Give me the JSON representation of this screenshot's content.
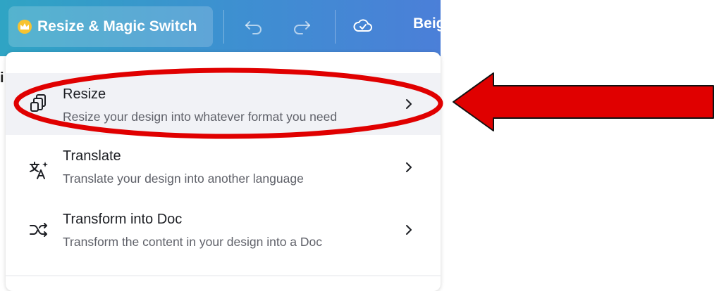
{
  "toolbar": {
    "resize_button_label": "Resize & Magic Switch",
    "project_name": "Beig",
    "icons": [
      "crown-icon",
      "undo-icon",
      "redo-icon",
      "cloud-check-icon"
    ]
  },
  "background": {
    "cropped_text": "i"
  },
  "menu": {
    "items": [
      {
        "title": "Resize",
        "description": "Resize your design into whatever format you need",
        "icon": "resize-icon",
        "highlighted": true
      },
      {
        "title": "Translate",
        "description": "Translate your design into another language",
        "icon": "translate-icon",
        "highlighted": false
      },
      {
        "title": "Transform into Doc",
        "description": "Transform the content in your design into a Doc",
        "icon": "transform-icon",
        "highlighted": false
      }
    ]
  },
  "annotations": {
    "ellipse_color": "#e00000",
    "arrow_color": "#e00000",
    "arrow_outline": "#111111"
  },
  "colors": {
    "toolbar_start": "#2fa4c4",
    "toolbar_end": "#4b7fd8",
    "highlight_row": "#f1f2f6",
    "crown": "#f7c331"
  }
}
